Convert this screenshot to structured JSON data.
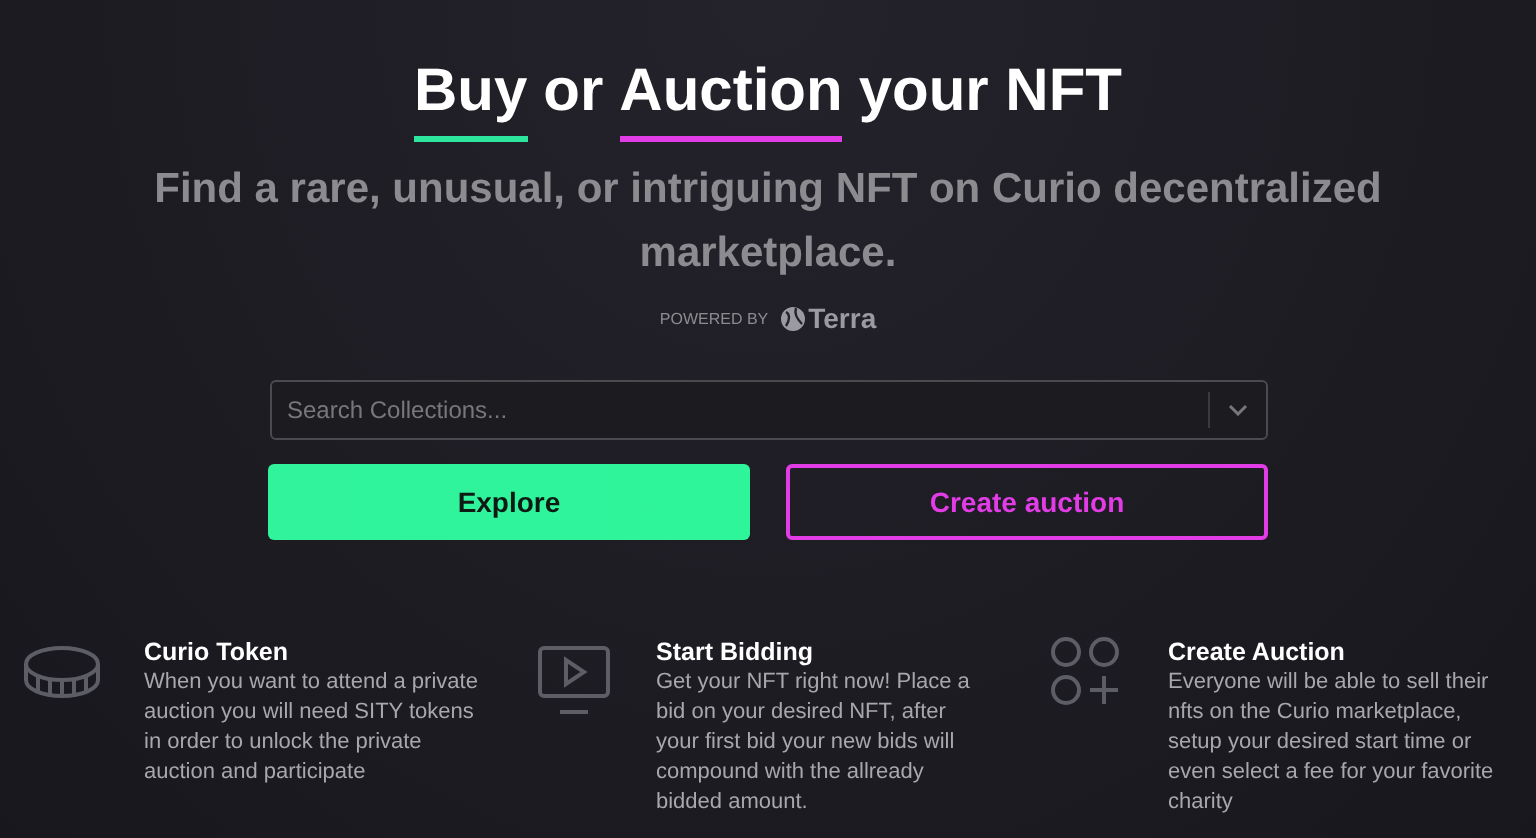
{
  "hero": {
    "title": [
      {
        "text": "Buy",
        "color": "#2ee59d"
      },
      {
        "text": "or"
      },
      {
        "text": "Auction",
        "color": "#e23ce6"
      },
      {
        "text": "your NFT"
      }
    ],
    "subtitle": "Find a rare, unusual, or intriguing NFT on Curio decentralized marketplace.",
    "powered_by": {
      "label": "POWERED BY",
      "brand": "Terra"
    }
  },
  "search": {
    "placeholder": "Search Collections..."
  },
  "buttons": [
    {
      "label": "Explore",
      "kind": "primary"
    },
    {
      "label": "Create auction",
      "kind": "outline"
    }
  ],
  "features": [
    {
      "kind": "coin",
      "title": "Curio Token",
      "text": "When you want to attend a private auction you will need SITY tokens in order to unlock the private auction and participate"
    },
    {
      "kind": "play",
      "title": "Start Bidding",
      "text": "Get your NFT right now! Place a bid on your desired NFT, after your first bid your new bids will compound with the allready bidded amount."
    },
    {
      "kind": "add",
      "title": "Create Auction",
      "text": "Everyone will be able to sell their nfts on the Curio marketplace, setup your desired start time or even select a fee for your favorite charity"
    }
  ]
}
